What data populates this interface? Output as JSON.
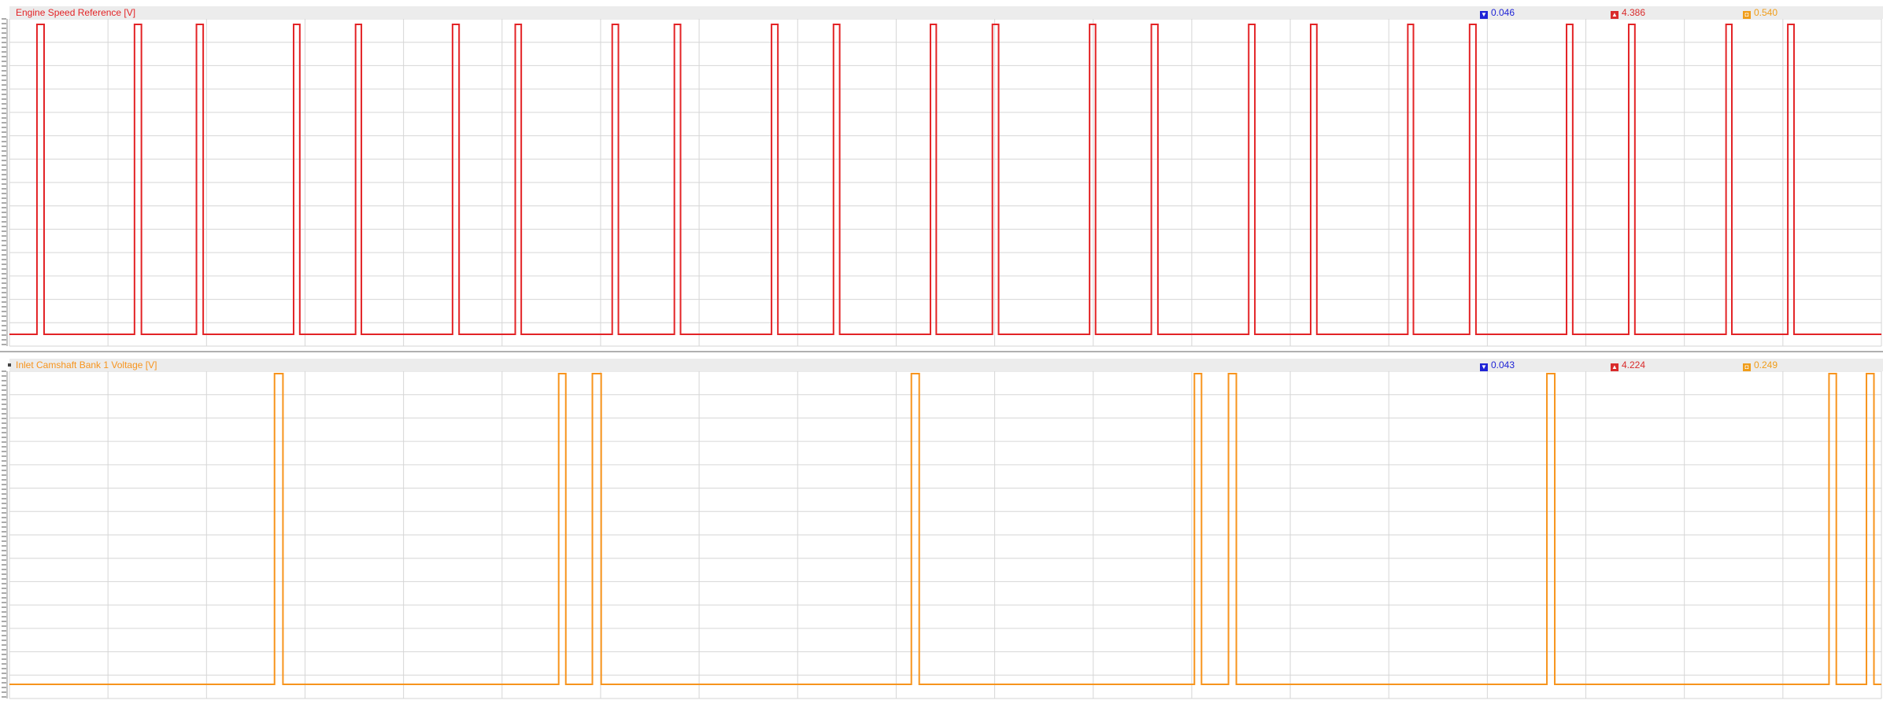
{
  "panels": {
    "top": {
      "title": "Engine Speed Reference [V]",
      "color": "#e32326",
      "stat_min": "0.046",
      "stat_max": "4.386",
      "stat_avg": "0.540"
    },
    "bottom": {
      "title": "Inlet Camshaft Bank 1 Voltage [V]",
      "color": "#f7941d",
      "stat_min": "0.043",
      "stat_max": "4.224",
      "stat_avg": "0.249"
    }
  },
  "icons": {
    "min": "triangle-down-icon",
    "max": "triangle-up-icon",
    "avg": "average-icon"
  },
  "chart_data": [
    {
      "type": "line",
      "title": "Engine Speed Reference [V]",
      "signal": "square-wave",
      "low": 0.05,
      "high": 4.39,
      "pulses_x_fraction": [
        [
          0.0147,
          0.0185
        ],
        [
          0.0668,
          0.0705
        ],
        [
          0.0999,
          0.1035
        ],
        [
          0.1518,
          0.1551
        ],
        [
          0.1849,
          0.188
        ],
        [
          0.2367,
          0.2402
        ],
        [
          0.2702,
          0.2734
        ],
        [
          0.322,
          0.3253
        ],
        [
          0.3552,
          0.3585
        ],
        [
          0.4071,
          0.4105
        ],
        [
          0.4402,
          0.4435
        ],
        [
          0.492,
          0.4951
        ],
        [
          0.5251,
          0.5284
        ],
        [
          0.577,
          0.5802
        ],
        [
          0.61,
          0.6135
        ],
        [
          0.662,
          0.6653
        ],
        [
          0.6951,
          0.6984
        ],
        [
          0.747,
          0.75
        ],
        [
          0.78,
          0.7834
        ],
        [
          0.8318,
          0.8351
        ],
        [
          0.865,
          0.8683
        ],
        [
          0.917,
          0.9201
        ],
        [
          0.95,
          0.9533
        ]
      ]
    },
    {
      "type": "line",
      "title": "Inlet Camshaft Bank 1 Voltage [V]",
      "signal": "square-wave",
      "low": 0.04,
      "high": 4.22,
      "pulses_x_fraction": [
        [
          0.1416,
          0.1461
        ],
        [
          0.2934,
          0.2972
        ],
        [
          0.3114,
          0.3161
        ],
        [
          0.4818,
          0.486
        ],
        [
          0.633,
          0.6368
        ],
        [
          0.6512,
          0.6554
        ],
        [
          0.8213,
          0.8255
        ],
        [
          0.972,
          0.9759
        ],
        [
          0.992,
          0.996
        ]
      ]
    }
  ]
}
